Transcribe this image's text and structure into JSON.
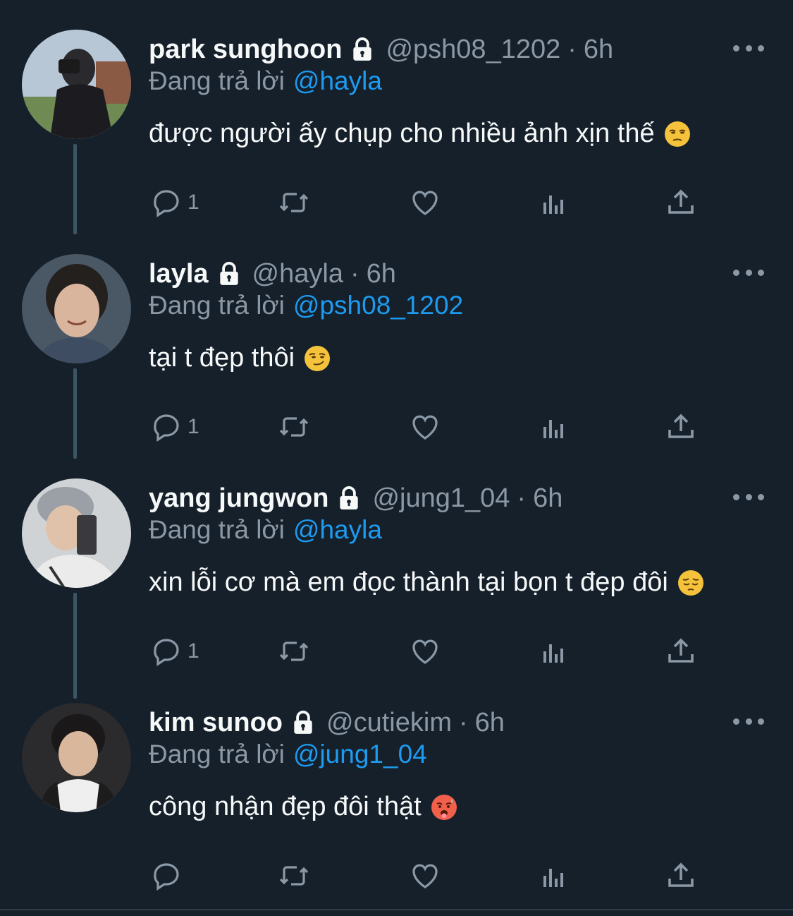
{
  "colors": {
    "background": "#15202b",
    "text_primary": "#f7f9f9",
    "text_secondary": "#8b98a5",
    "accent": "#1d9bf0",
    "thread_line": "#3d5466"
  },
  "tweets": [
    {
      "display_name": "park sunghoon",
      "locked": true,
      "handle": "@psh08_1202",
      "separator": "·",
      "time": "6h",
      "reply_prefix": "Đang trả lời",
      "reply_to": "@hayla",
      "text": "được người ấy chụp cho nhiều ảnh xịn thế",
      "emoji": "unamused-face",
      "reply_count": "1"
    },
    {
      "display_name": "layla",
      "locked": true,
      "handle": "@hayla",
      "separator": "·",
      "time": "6h",
      "reply_prefix": "Đang trả lời",
      "reply_to": "@psh08_1202",
      "text": "tại t đẹp thôi",
      "emoji": "smirking-face",
      "reply_count": "1"
    },
    {
      "display_name": "yang jungwon",
      "locked": true,
      "handle": "@jung1_04",
      "separator": "·",
      "time": "6h",
      "reply_prefix": "Đang trả lời",
      "reply_to": "@hayla",
      "text": "xin lỗi cơ mà em đọc thành tại bọn t đẹp đôi",
      "emoji": "pensive-face",
      "reply_count": "1"
    },
    {
      "display_name": "kim sunoo",
      "locked": true,
      "handle": "@cutiekim",
      "separator": "·",
      "time": "6h",
      "reply_prefix": "Đang trả lời",
      "reply_to": "@jung1_04",
      "text": "công nhận đẹp đôi thật",
      "emoji": "hot-face",
      "reply_count": ""
    }
  ],
  "icons": {
    "reply": "reply-icon",
    "retweet": "retweet-icon",
    "like": "like-icon",
    "views": "views-icon",
    "share": "share-icon",
    "lock": "lock-icon",
    "more": "more-icon"
  }
}
